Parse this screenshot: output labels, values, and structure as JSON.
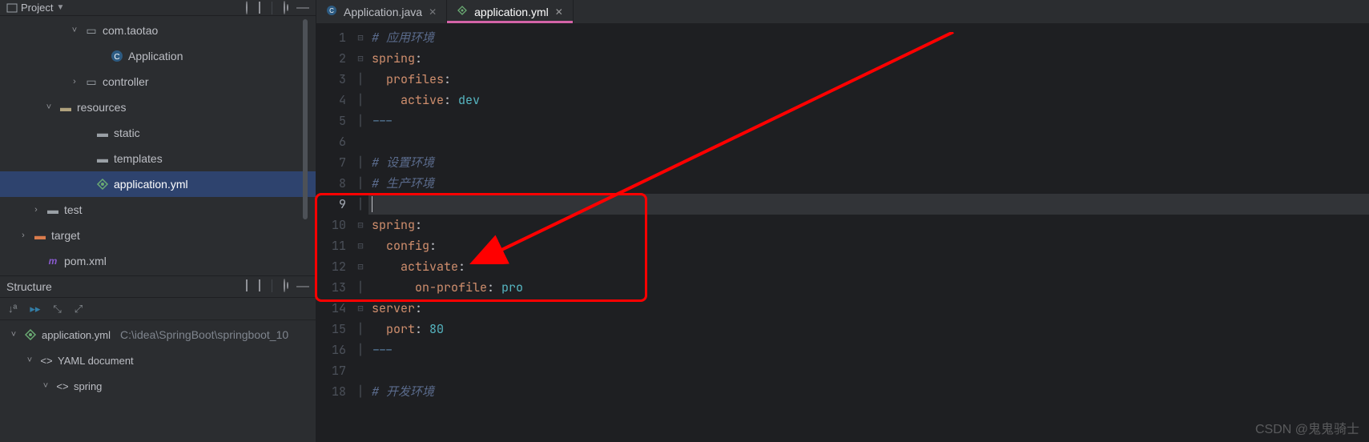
{
  "project_header": {
    "title": "Project"
  },
  "tree": {
    "package": "com.taotao",
    "application_class": "Application",
    "controller": "controller",
    "resources": "resources",
    "static": "static",
    "templates": "templates",
    "app_yml": "application.yml",
    "test": "test",
    "target": "target",
    "pom": "pom.xml"
  },
  "structure_header": {
    "title": "Structure"
  },
  "structure": {
    "root_file": "application.yml",
    "root_path": "C:\\idea\\SpringBoot\\springboot_10",
    "yaml_doc": "YAML document",
    "spring_key": "spring"
  },
  "tabs": [
    {
      "label": "Application.java",
      "type": "java"
    },
    {
      "label": "application.yml",
      "type": "yml"
    }
  ],
  "gutter_start": 1,
  "gutter_end": 18,
  "current_line": 9,
  "code": {
    "l1": {
      "text": "# 应用环境",
      "type": "comment"
    },
    "l2": {
      "key": "spring",
      "value": "",
      "colon": true
    },
    "l3": {
      "indent": 1,
      "key": "profiles",
      "colon": true
    },
    "l4": {
      "indent": 2,
      "key": "active",
      "value": "dev"
    },
    "l5": {
      "sep": "---"
    },
    "l6": {
      "blank": true
    },
    "l7": {
      "text": "# 设置环境",
      "type": "comment"
    },
    "l8": {
      "text": "# 生产环境",
      "type": "comment"
    },
    "l9": {
      "blank": true
    },
    "l10": {
      "key": "spring",
      "colon": true
    },
    "l11": {
      "indent": 1,
      "key": "config",
      "colon": true
    },
    "l12": {
      "indent": 2,
      "key": "activate",
      "colon": true
    },
    "l13": {
      "indent": 3,
      "key": "on-profile",
      "value": "pro"
    },
    "l14": {
      "key": "server",
      "colon": true
    },
    "l15": {
      "indent": 1,
      "key": "port",
      "value": "80"
    },
    "l16": {
      "sep": "---"
    },
    "l17": {
      "blank": true
    },
    "l18": {
      "text": "# 开发环境",
      "type": "comment"
    }
  },
  "watermark": "CSDN @鬼鬼骑士",
  "colors": {
    "accent_pink": "#d463a8",
    "annotation_red": "#ff0000",
    "selection_blue": "#2e436e"
  }
}
